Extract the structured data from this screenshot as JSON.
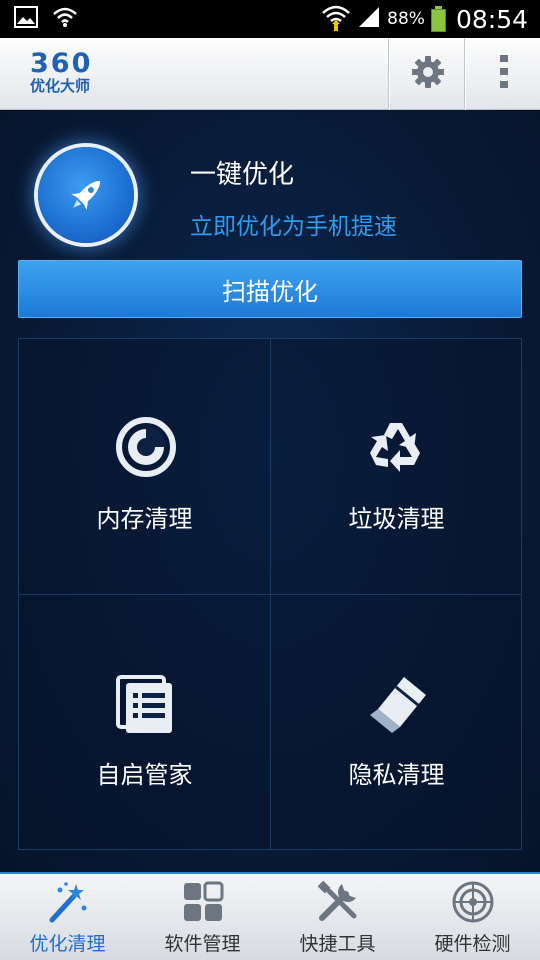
{
  "status_bar": {
    "battery_percent": "88%",
    "time": "08:54",
    "icons": [
      "image-icon",
      "wifi-icon",
      "wifi-signal-icon",
      "cell-signal-icon",
      "battery-icon"
    ]
  },
  "app_header": {
    "logo_number": "360",
    "logo_name": "优化大师",
    "icons": [
      "settings-gear-icon",
      "more-vertical-icon"
    ]
  },
  "hero": {
    "title": "一键优化",
    "subtitle": "立即优化为手机提速",
    "icon": "rocket-icon"
  },
  "scan_button": {
    "label": "扫描优化"
  },
  "tiles": [
    {
      "label": "内存清理",
      "icon": "memory-clean-icon"
    },
    {
      "label": "垃圾清理",
      "icon": "recycle-icon"
    },
    {
      "label": "自启管家",
      "icon": "list-icon"
    },
    {
      "label": "隐私清理",
      "icon": "eraser-icon"
    }
  ],
  "bottom_nav": {
    "items": [
      {
        "label": "优化清理",
        "icon": "magic-wand-icon",
        "active": true
      },
      {
        "label": "软件管理",
        "icon": "app-grid-icon",
        "active": false
      },
      {
        "label": "快捷工具",
        "icon": "tools-icon",
        "active": false
      },
      {
        "label": "硬件检测",
        "icon": "radar-icon",
        "active": false
      }
    ],
    "active_color": "#1d6fd2"
  },
  "colors": {
    "accent": "#1d6fd2",
    "subtitle": "#2d9bf0",
    "background": "#081a36"
  }
}
